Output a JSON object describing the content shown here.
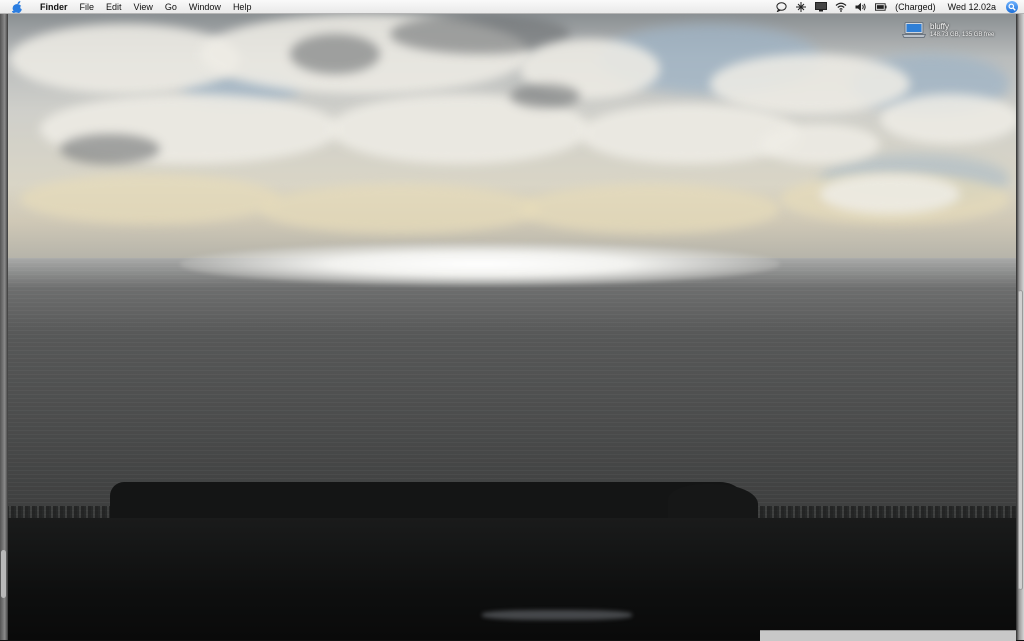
{
  "menubar": {
    "app_name": "Finder",
    "items": [
      "File",
      "Edit",
      "View",
      "Go",
      "Window",
      "Help"
    ],
    "status": {
      "battery_label": "(Charged)",
      "clock": "Wed 12.02a"
    },
    "icons": [
      "apple-icon",
      "speech-bubble-icon",
      "network-icon",
      "display-icon",
      "wifi-icon",
      "volume-icon",
      "battery-icon",
      "spotlight-icon"
    ]
  },
  "desktop": {
    "drive": {
      "name": "bluffy",
      "info": "148.73 GB, 135 GB free"
    },
    "wallpaper": "ocean-horizon-clouds"
  },
  "colors": {
    "menubar_bg": "#f0f0f0",
    "spotlight": "#1d6fd8"
  }
}
